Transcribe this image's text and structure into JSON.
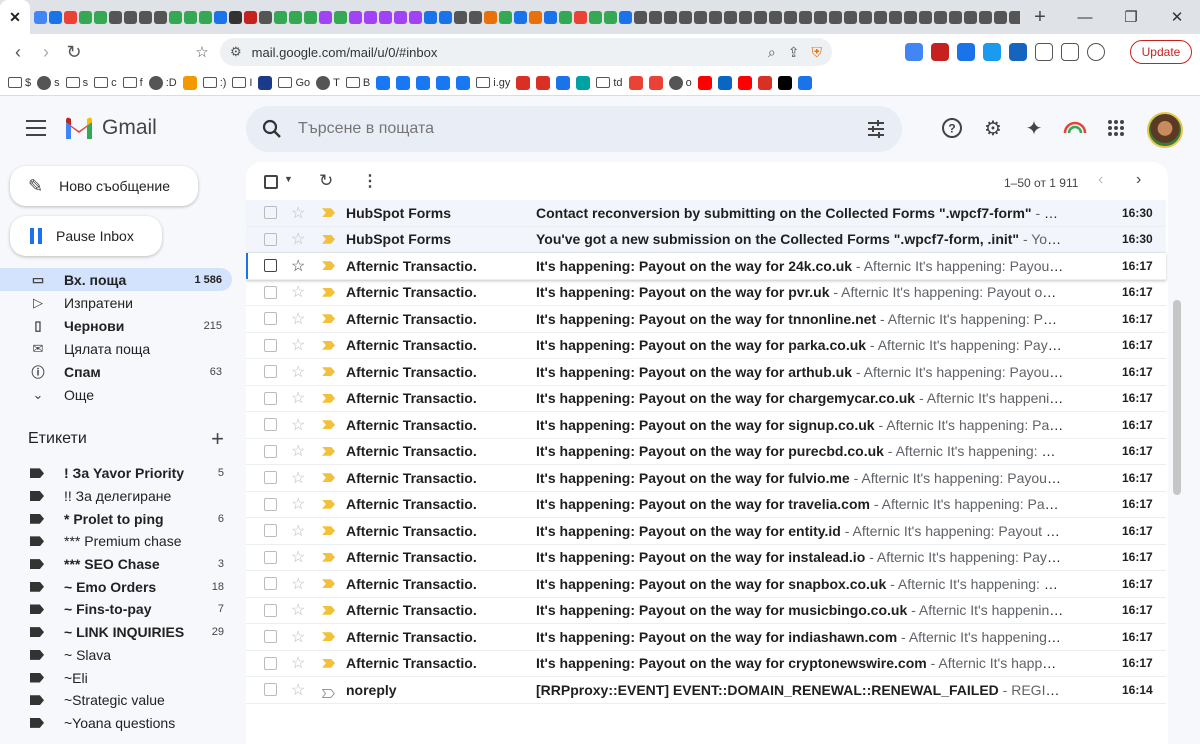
{
  "browser": {
    "tab_close": "✕",
    "new_tab": "+",
    "url": "mail.google.com/mail/u/0/#inbox",
    "update_label": "Update",
    "tab_icon_colors": [
      "#4285f4",
      "#1a73e8",
      "#ea4335",
      "#34a853",
      "#34a853",
      "#555",
      "#555",
      "#555",
      "#555",
      "#34a853",
      "#34a853",
      "#34a853",
      "#1a73e8",
      "#333",
      "#c5221f",
      "#555",
      "#34a853",
      "#34a853",
      "#34a853",
      "#a142f4",
      "#34a853",
      "#a142f4",
      "#a142f4",
      "#a142f4",
      "#a142f4",
      "#a142f4",
      "#1a73e8",
      "#1a73e8",
      "#555",
      "#555",
      "#e8710a",
      "#34a853",
      "#1a73e8",
      "#e8710a",
      "#1a73e8",
      "#34a853",
      "#ea4335",
      "#34a853",
      "#34a853",
      "#1a73e8",
      "#555",
      "#555",
      "#555",
      "#555",
      "#555",
      "#555",
      "#555",
      "#555",
      "#555",
      "#555",
      "#555",
      "#555",
      "#555",
      "#555",
      "#555",
      "#555",
      "#555",
      "#555",
      "#555",
      "#555",
      "#555",
      "#555",
      "#555",
      "#555",
      "#555",
      "#555",
      "#555",
      "#555",
      "#555",
      "#555",
      "#555",
      "#555"
    ]
  },
  "bookmarks": [
    {
      "icon": "folder",
      "label": "$"
    },
    {
      "icon": "circle",
      "label": "s"
    },
    {
      "icon": "folder",
      "label": "s"
    },
    {
      "icon": "folder",
      "label": "c"
    },
    {
      "icon": "folder",
      "label": "f"
    },
    {
      "icon": "globe",
      "label": ":D"
    },
    {
      "icon": "orange",
      "label": ""
    },
    {
      "icon": "folder",
      "label": ":)"
    },
    {
      "icon": "folder",
      "label": "I"
    },
    {
      "icon": "n",
      "label": ""
    },
    {
      "icon": "folder",
      "label": "Go"
    },
    {
      "icon": "globe",
      "label": "T"
    },
    {
      "icon": "folder",
      "label": "B"
    },
    {
      "icon": "facebook",
      "label": ""
    },
    {
      "icon": "facebook",
      "label": ""
    },
    {
      "icon": "facebook",
      "label": ""
    },
    {
      "icon": "facebook",
      "label": ""
    },
    {
      "icon": "facebook",
      "label": ""
    },
    {
      "icon": "folder",
      "label": "i.gy"
    },
    {
      "icon": "red",
      "label": ""
    },
    {
      "icon": "red",
      "label": ""
    },
    {
      "icon": "blue",
      "label": ""
    },
    {
      "icon": "teal",
      "label": ""
    },
    {
      "icon": "folder",
      "label": "td"
    },
    {
      "icon": "gmail",
      "label": ""
    },
    {
      "icon": "gmail",
      "label": ""
    },
    {
      "icon": "circle",
      "label": "o"
    },
    {
      "icon": "youtube",
      "label": ""
    },
    {
      "icon": "linkedin",
      "label": ""
    },
    {
      "icon": "youtube",
      "label": ""
    },
    {
      "icon": "red",
      "label": ""
    },
    {
      "icon": "x",
      "label": ""
    },
    {
      "icon": "blue",
      "label": ""
    }
  ],
  "gmail": {
    "logo_text": "Gmail",
    "search_placeholder": "Търсене в пощата",
    "compose_label": "Ново съобщение",
    "pause_label": "Pause Inbox",
    "nav": [
      {
        "name": "inbox",
        "icon": "inbox-icon",
        "glyph": "▭",
        "label": "Вх. поща",
        "count": "1 586",
        "active": true,
        "bold": true
      },
      {
        "name": "sent",
        "icon": "send-icon",
        "glyph": "▷",
        "label": "Изпратени",
        "count": "",
        "active": false,
        "bold": false
      },
      {
        "name": "drafts",
        "icon": "draft-icon",
        "glyph": "▯",
        "label": "Чернови",
        "count": "215",
        "active": false,
        "bold": true
      },
      {
        "name": "all-mail",
        "icon": "all-mail-icon",
        "glyph": "✉",
        "label": "Цялата поща",
        "count": "",
        "active": false,
        "bold": false
      },
      {
        "name": "spam",
        "icon": "spam-icon",
        "glyph": "ⓘ",
        "label": "Спам",
        "count": "63",
        "active": false,
        "bold": true
      },
      {
        "name": "more",
        "icon": "chevron-down-icon",
        "glyph": "⌄",
        "label": "Още",
        "count": "",
        "active": false,
        "bold": false
      }
    ],
    "labels_header": "Етикети",
    "labels": [
      {
        "label": "! За Yavor Priority",
        "count": "5",
        "bold": true
      },
      {
        "label": "!! За делегиране",
        "count": "",
        "bold": false
      },
      {
        "label": "* Prolet to ping",
        "count": "6",
        "bold": true
      },
      {
        "label": "*** Premium chase",
        "count": "",
        "bold": false
      },
      {
        "label": "*** SEO Chase",
        "count": "3",
        "bold": true
      },
      {
        "label": "~ Emo Orders",
        "count": "18",
        "bold": true
      },
      {
        "label": "~ Fins-to-pay",
        "count": "7",
        "bold": true
      },
      {
        "label": "~ LINK INQUIRIES",
        "count": "29",
        "bold": true
      },
      {
        "label": "~ Slava",
        "count": "",
        "bold": false
      },
      {
        "label": "~Eli",
        "count": "",
        "bold": false
      },
      {
        "label": "~Strategic value",
        "count": "",
        "bold": false
      },
      {
        "label": "~Yoana questions",
        "count": "",
        "bold": false
      }
    ],
    "toolbar": {
      "range": "1–50 от 1 911"
    },
    "emails": [
      {
        "sender": "HubSpot Forms",
        "subject": "Contact reconversion by submitting on the Collected Forms \".wpcf7-form\"",
        "snippet": " - Con...",
        "time": "16:30",
        "important": true,
        "read": true
      },
      {
        "sender": "HubSpot Forms",
        "subject": "You've got a new submission on the Collected Forms \".wpcf7-form, .init\"",
        "snippet": " - You've ...",
        "time": "16:30",
        "important": true,
        "read": true
      },
      {
        "sender": "Afternic Transactio.",
        "subject": "It's happening: Payout on the way for 24k.co.uk",
        "snippet": " - Afternic It's happening: Payout o...",
        "time": "16:17",
        "important": true,
        "read": false,
        "hovered": true
      },
      {
        "sender": "Afternic Transactio.",
        "subject": "It's happening: Payout on the way for pvr.uk",
        "snippet": " - Afternic It's happening: Payout on th...",
        "time": "16:17",
        "important": true,
        "read": false
      },
      {
        "sender": "Afternic Transactio.",
        "subject": "It's happening: Payout on the way for tnnonline.net",
        "snippet": " - Afternic It's happening: Payo...",
        "time": "16:17",
        "important": true,
        "read": false
      },
      {
        "sender": "Afternic Transactio.",
        "subject": "It's happening: Payout on the way for parka.co.uk",
        "snippet": " - Afternic It's happening: Payout...",
        "time": "16:17",
        "important": true,
        "read": false
      },
      {
        "sender": "Afternic Transactio.",
        "subject": "It's happening: Payout on the way for arthub.uk",
        "snippet": " - Afternic It's happening: Payout o...",
        "time": "16:17",
        "important": true,
        "read": false
      },
      {
        "sender": "Afternic Transactio.",
        "subject": "It's happening: Payout on the way for chargemycar.co.uk",
        "snippet": " - Afternic It's happening...",
        "time": "16:17",
        "important": true,
        "read": false
      },
      {
        "sender": "Afternic Transactio.",
        "subject": "It's happening: Payout on the way for signup.co.uk",
        "snippet": " - Afternic It's happening: Payou...",
        "time": "16:17",
        "important": true,
        "read": false
      },
      {
        "sender": "Afternic Transactio.",
        "subject": "It's happening: Payout on the way for purecbd.co.uk",
        "snippet": " - Afternic It's happening: Pay...",
        "time": "16:17",
        "important": true,
        "read": false
      },
      {
        "sender": "Afternic Transactio.",
        "subject": "It's happening: Payout on the way for fulvio.me",
        "snippet": " - Afternic It's happening: Payout o...",
        "time": "16:17",
        "important": true,
        "read": false
      },
      {
        "sender": "Afternic Transactio.",
        "subject": "It's happening: Payout on the way for travelia.com",
        "snippet": " - Afternic It's happening: Payou...",
        "time": "16:17",
        "important": true,
        "read": false
      },
      {
        "sender": "Afternic Transactio.",
        "subject": "It's happening: Payout on the way for entity.id",
        "snippet": " - Afternic It's happening: Payout on ...",
        "time": "16:17",
        "important": true,
        "read": false
      },
      {
        "sender": "Afternic Transactio.",
        "subject": "It's happening: Payout on the way for instalead.io",
        "snippet": " - Afternic It's happening: Payout...",
        "time": "16:17",
        "important": true,
        "read": false
      },
      {
        "sender": "Afternic Transactio.",
        "subject": "It's happening: Payout on the way for snapbox.co.uk",
        "snippet": " - Afternic It's happening: Pay...",
        "time": "16:17",
        "important": true,
        "read": false
      },
      {
        "sender": "Afternic Transactio.",
        "subject": "It's happening: Payout on the way for musicbingo.co.uk",
        "snippet": " - Afternic It's happening: ...",
        "time": "16:17",
        "important": true,
        "read": false
      },
      {
        "sender": "Afternic Transactio.",
        "subject": "It's happening: Payout on the way for indiashawn.com",
        "snippet": " - Afternic It's happening: P...",
        "time": "16:17",
        "important": true,
        "read": false
      },
      {
        "sender": "Afternic Transactio.",
        "subject": "It's happening: Payout on the way for cryptonewswire.com",
        "snippet": " - Afternic It's happening...",
        "time": "16:17",
        "important": true,
        "read": false
      },
      {
        "sender": "noreply",
        "subject": "[RRPproxy::EVENT] EVENT::DOMAIN_RENEWAL::RENEWAL_FAILED",
        "snippet": " - REGISTRAR:...",
        "time": "16:14",
        "important": false,
        "read": false
      }
    ]
  }
}
